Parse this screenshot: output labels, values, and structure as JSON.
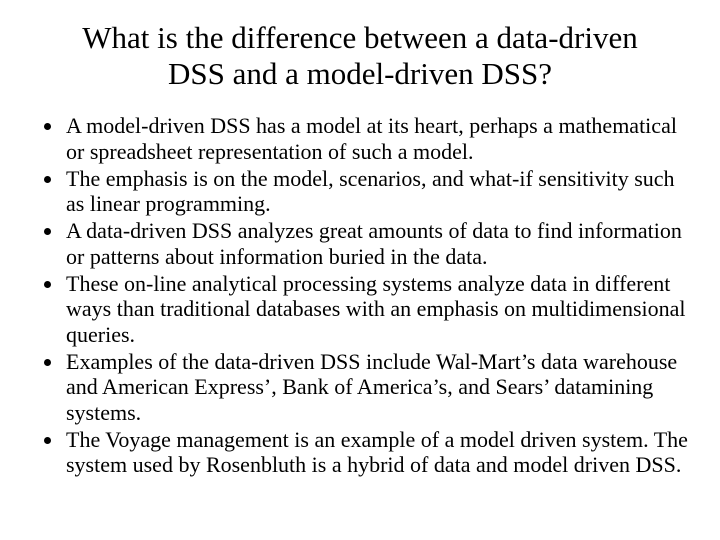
{
  "title": "What is the difference between a data-driven DSS and a model-driven DSS?",
  "bullets": [
    "A model-driven DSS has a model at its heart, perhaps a mathematical or spreadsheet representation of such a model.",
    "The emphasis is on the model, scenarios, and what-if sensitivity such as linear programming.",
    "A data-driven DSS analyzes great amounts of data to find information or patterns about information buried in the data.",
    "These on-line analytical processing systems analyze data in different ways than traditional databases with an emphasis on multidimensional queries.",
    "Examples of the data-driven DSS include Wal-Mart’s data warehouse and American Express’, Bank of America’s, and Sears’ datamining systems.",
    " The Voyage management is an example of a model driven system. The system used by Rosenbluth is a hybrid of data and model driven DSS."
  ]
}
